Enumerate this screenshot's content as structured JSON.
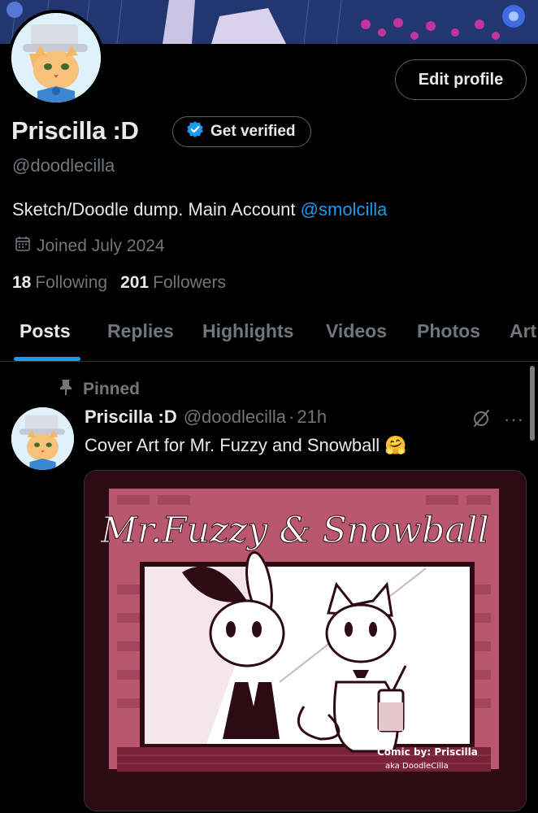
{
  "profile": {
    "display_name": "Priscilla :D",
    "handle": "@doodlecilla",
    "bio_text": "Sketch/Doodle dump. Main Account ",
    "bio_mention": "@smolcilla",
    "joined": "Joined July 2024",
    "following_count": "18",
    "following_label": "Following",
    "followers_count": "201",
    "followers_label": "Followers"
  },
  "actions": {
    "edit_profile": "Edit profile",
    "get_verified": "Get verified"
  },
  "tabs": [
    {
      "label": "Posts",
      "active": true
    },
    {
      "label": "Replies",
      "active": false
    },
    {
      "label": "Highlights",
      "active": false
    },
    {
      "label": "Videos",
      "active": false
    },
    {
      "label": "Photos",
      "active": false
    },
    {
      "label": "Art",
      "active": false
    }
  ],
  "pinned_post": {
    "pinned_label": "Pinned",
    "author": "Priscilla :D",
    "handle": "@doodlecilla",
    "separator": "·",
    "time": "21h",
    "text": "Cover Art for Mr. Fuzzy and Snowball",
    "emoji": "🤗",
    "image": {
      "title": "Mr.Fuzzy & Snowball",
      "credit_line1": "Comic by: Priscilla",
      "credit_line2": "aka DoodleCilla"
    }
  },
  "colors": {
    "background": "#000000",
    "text_primary": "#e7e9ea",
    "text_secondary": "#71767b",
    "accent": "#1d9bf0",
    "border": "#2f3336",
    "art_pink": "#b8576e",
    "art_dark": "#2d0a14"
  },
  "icons": {
    "verified": "verified-badge-icon",
    "calendar": "calendar-icon",
    "pin": "pin-icon",
    "grok": "grok-icon",
    "more": "more-icon"
  }
}
